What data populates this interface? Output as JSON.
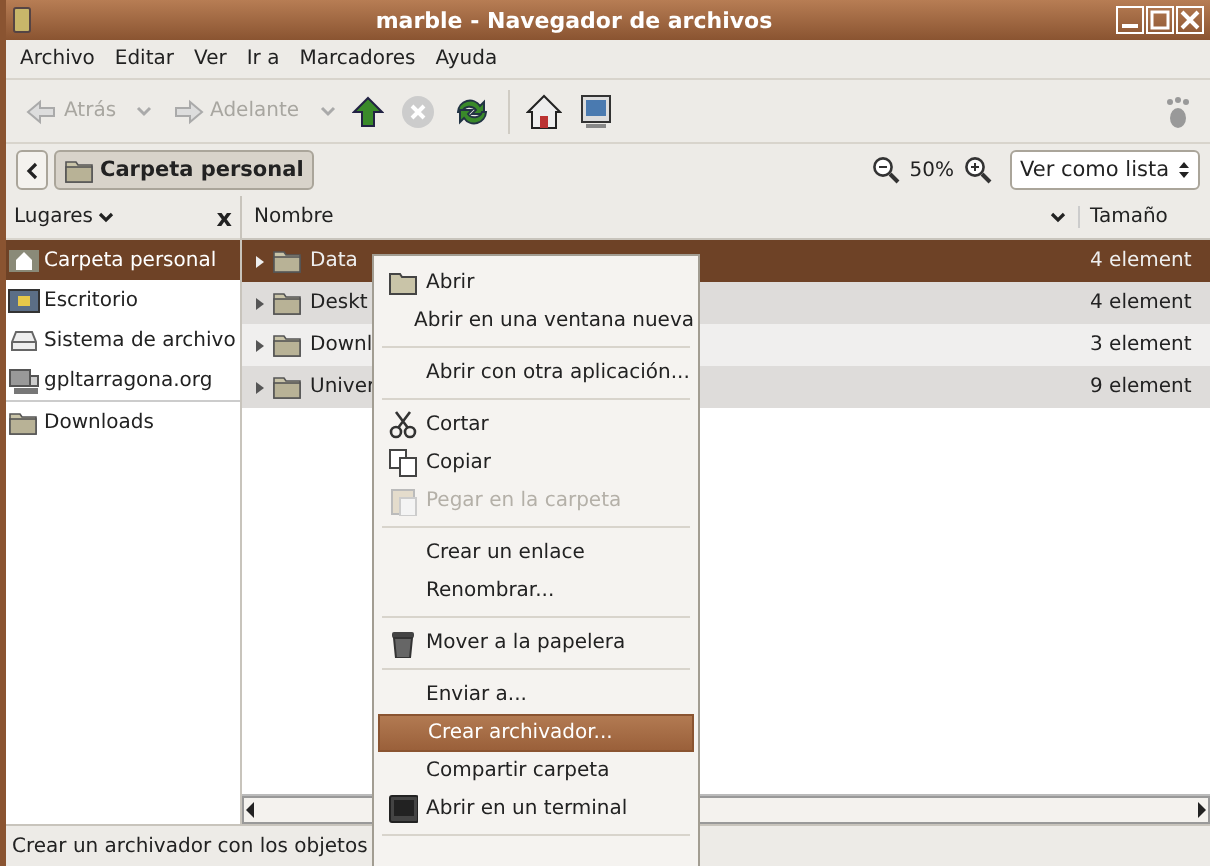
{
  "window": {
    "title": "marble - Navegador de archivos"
  },
  "menubar": [
    "Archivo",
    "Editar",
    "Ver",
    "Ir a",
    "Marcadores",
    "Ayuda"
  ],
  "toolbar": [
    {
      "kind": "back",
      "label": "Atrás",
      "disabled": true
    },
    {
      "kind": "forward",
      "label": "Adelante",
      "disabled": true
    },
    {
      "kind": "up",
      "disabled": false
    },
    {
      "kind": "stop",
      "disabled": true
    },
    {
      "kind": "reload",
      "disabled": false
    },
    {
      "kind": "home",
      "disabled": false
    },
    {
      "kind": "computer",
      "disabled": false
    }
  ],
  "location": {
    "path_button": "Carpeta personal",
    "zoom": "50%",
    "view_mode": "Ver como lista"
  },
  "sidebar": {
    "title": "Lugares",
    "close": "x",
    "items": [
      {
        "label": "Carpeta personal",
        "selected": true
      },
      {
        "label": "Escritorio",
        "selected": false
      },
      {
        "label": "Sistema de archivo",
        "selected": false
      },
      {
        "label": "gpltarragona.org",
        "selected": false
      },
      {
        "label": "Downloads",
        "selected": false
      }
    ]
  },
  "table": {
    "columns": [
      "Nombre",
      "Tamaño"
    ],
    "rows": [
      {
        "name": "Data",
        "size": "4 element",
        "selected": true
      },
      {
        "name": "Deskt",
        "size": "4 element",
        "selected": false
      },
      {
        "name": "Downl",
        "size": "3 element",
        "selected": false
      },
      {
        "name": "Univer",
        "size": "9 element",
        "selected": false
      }
    ]
  },
  "context_menu": [
    {
      "kind": "item",
      "label": "Abrir",
      "disabled": false,
      "selected": false
    },
    {
      "kind": "item",
      "label": "Abrir en una ventana nueva",
      "disabled": false,
      "selected": false
    },
    {
      "kind": "separator"
    },
    {
      "kind": "item",
      "label": "Abrir con otra aplicación...",
      "disabled": false,
      "selected": false
    },
    {
      "kind": "separator"
    },
    {
      "kind": "item",
      "label": "Cortar",
      "disabled": false,
      "selected": false
    },
    {
      "kind": "item",
      "label": "Copiar",
      "disabled": false,
      "selected": false
    },
    {
      "kind": "item",
      "label": "Pegar en la carpeta",
      "disabled": true,
      "selected": false
    },
    {
      "kind": "separator"
    },
    {
      "kind": "item",
      "label": "Crear un enlace",
      "disabled": false,
      "selected": false
    },
    {
      "kind": "item",
      "label": "Renombrar...",
      "disabled": false,
      "selected": false
    },
    {
      "kind": "separator"
    },
    {
      "kind": "item",
      "label": "Mover a la papelera",
      "disabled": false,
      "selected": false
    },
    {
      "kind": "separator"
    },
    {
      "kind": "item",
      "label": "Enviar a...",
      "disabled": false,
      "selected": false
    },
    {
      "kind": "item",
      "label": "Crear archivador...",
      "disabled": false,
      "selected": true
    },
    {
      "kind": "item",
      "label": "Compartir carpeta",
      "disabled": false,
      "selected": false
    },
    {
      "kind": "item",
      "label": "Abrir en un terminal",
      "disabled": false,
      "selected": false
    },
    {
      "kind": "separator"
    }
  ],
  "status_bar": "Crear un archivador con los objetos"
}
